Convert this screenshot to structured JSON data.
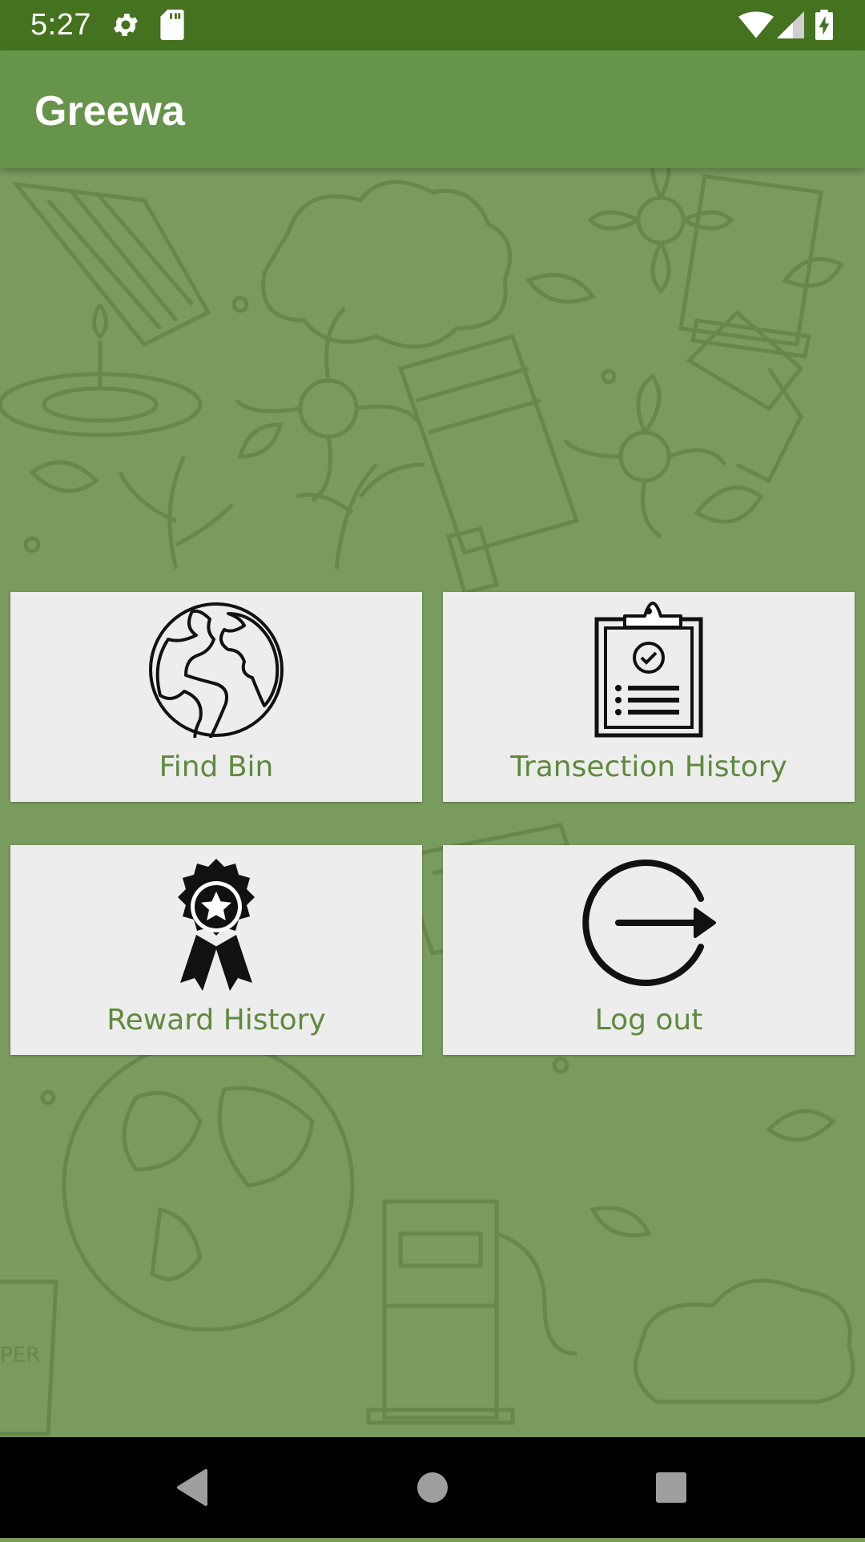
{
  "status_bar": {
    "time": "5:27",
    "icons": [
      "settings-icon",
      "sd-card-icon",
      "wifi-icon",
      "cell-signal-icon",
      "battery-charging-icon"
    ]
  },
  "app_bar": {
    "title": "Greewa"
  },
  "menu": {
    "items": [
      {
        "label": "Find Bin",
        "icon": "globe-icon"
      },
      {
        "label": "Transection History",
        "icon": "clipboard-check-icon"
      },
      {
        "label": "Reward History",
        "icon": "award-badge-icon"
      },
      {
        "label": "Log out",
        "icon": "logout-icon"
      }
    ]
  },
  "nav_bar": {
    "icons": [
      "back-icon",
      "home-icon",
      "recents-icon"
    ]
  },
  "colors": {
    "status_bar": "#44721f",
    "app_bar": "#66944a",
    "background": "#7a9b5e",
    "card": "#ededed",
    "label_text": "#5f8a3e"
  }
}
